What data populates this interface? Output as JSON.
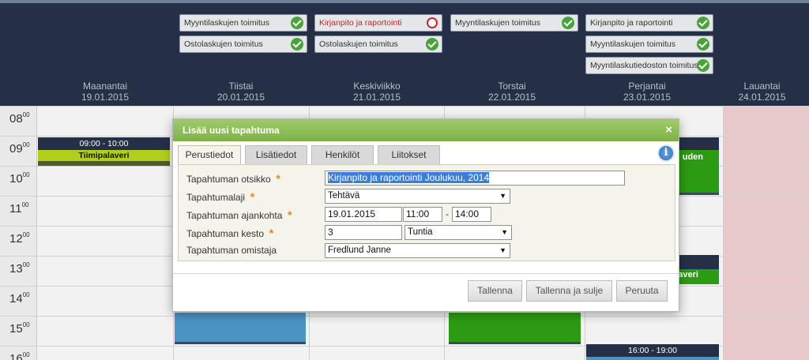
{
  "task_columns": [
    {
      "items": [
        {
          "label": "Myyntilaskujen toimitus",
          "status": "done"
        },
        {
          "label": "Ostolaskujen toimitus",
          "status": "done"
        }
      ]
    },
    {
      "items": [
        {
          "label": "Kirjanpito ja raportointi",
          "status": "pending"
        },
        {
          "label": "Ostolaskujen toimitus",
          "status": "done"
        }
      ]
    },
    {
      "items": [
        {
          "label": "Myyntilaskujen toimitus",
          "status": "done"
        }
      ]
    },
    {
      "items": [
        {
          "label": "Kirjanpito ja raportointi",
          "status": "done"
        },
        {
          "label": "Myyntilaskujen toimitus",
          "status": "done"
        },
        {
          "label": "Myyntilaskutiedoston toimitus",
          "status": "done"
        }
      ]
    }
  ],
  "days": [
    {
      "name": "Maanantai",
      "date": "19.01.2015"
    },
    {
      "name": "Tiistai",
      "date": "20.01.2015"
    },
    {
      "name": "Keskiviikko",
      "date": "21.01.2015"
    },
    {
      "name": "Torstai",
      "date": "22.01.2015"
    },
    {
      "name": "Perjantai",
      "date": "23.01.2015"
    },
    {
      "name": "Lauantai",
      "date": "24.01.2015"
    }
  ],
  "hours": [
    {
      "h": "08",
      "m": "00"
    },
    {
      "h": "09",
      "m": "00"
    },
    {
      "h": "10",
      "m": "00"
    },
    {
      "h": "11",
      "m": "00"
    },
    {
      "h": "12",
      "m": "00"
    },
    {
      "h": "13",
      "m": "00"
    },
    {
      "h": "14",
      "m": "00"
    },
    {
      "h": "15",
      "m": "00"
    },
    {
      "h": "16",
      "m": "00"
    }
  ],
  "events": {
    "mon_meeting": {
      "time": "09:00 - 10:00",
      "title": "Tiimipalaveri"
    },
    "fri_partial_1": {
      "title_fragment": "uden"
    },
    "fri_partial_2": {
      "title_fragment": "averi"
    },
    "fri_late": {
      "time": "16:00 - 19:00"
    }
  },
  "colors": {
    "header_bg": "#253047",
    "accent_green": "#2d9b12",
    "event_blue": "#4a94c4",
    "event_lime": "#b1cf1a",
    "saturday_bg": "#e8c9c9"
  },
  "dialog": {
    "title": "Lisää uusi tapahtuma",
    "close_glyph": "×",
    "info_glyph": "i",
    "tabs": [
      "Perustiedot",
      "Lisätiedot",
      "Henkilöt",
      "Liitokset"
    ],
    "active_tab": "Perustiedot",
    "required_mark": "*",
    "fields": {
      "title_label": "Tapahtuman otsikko",
      "title_value": "Kirjanpito ja raportointi Joulukuu, 2014",
      "type_label": "Tapahtumalaji",
      "type_value": "Tehtävä",
      "time_label": "Tapahtuman ajankohta",
      "date_value": "19.01.2015",
      "start_value": "11:00",
      "range_sep": "-",
      "end_value": "14:00",
      "duration_label": "Tapahtuman kesto",
      "duration_value": "3",
      "duration_unit": "Tuntia",
      "owner_label": "Tapahtuman omistaja",
      "owner_value": "Fredlund Janne"
    },
    "select_arrow": "▼",
    "buttons": {
      "save": "Tallenna",
      "save_close": "Tallenna ja sulje",
      "cancel": "Peruuta"
    }
  }
}
